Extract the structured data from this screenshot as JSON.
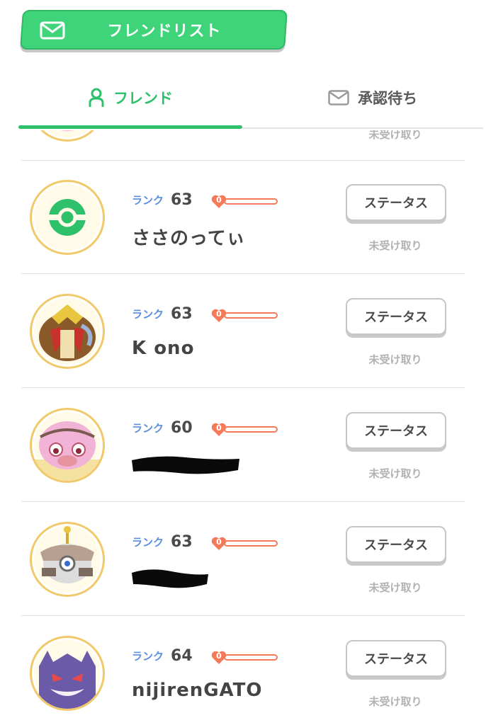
{
  "header": {
    "title": "フレンドリスト",
    "icon": "mail-icon"
  },
  "tabs": [
    {
      "label": "フレンド",
      "icon": "person-icon",
      "active": true
    },
    {
      "label": "承認待ち",
      "icon": "mail-icon",
      "active": false
    }
  ],
  "colors": {
    "accent": "#2ec06a",
    "rank_label": "#5a8fde",
    "heart": "#f47a5a"
  },
  "friends": [
    {
      "rank_label": "ランク",
      "rank": "63",
      "hearts": "0",
      "name": "ささのってぃ",
      "status_label": "ステータス",
      "gift_status": "未受け取り",
      "avatar": "pokeball-avatar"
    },
    {
      "rank_label": "ランク",
      "rank": "63",
      "hearts": "0",
      "name": "K ono",
      "status_label": "ステータス",
      "gift_status": "未受け取り",
      "avatar": "entei-avatar"
    },
    {
      "rank_label": "ランク",
      "rank": "60",
      "hearts": "0",
      "name": "",
      "status_label": "ステータス",
      "gift_status": "未受け取り",
      "avatar": "slowking-avatar"
    },
    {
      "rank_label": "ランク",
      "rank": "63",
      "hearts": "0",
      "name": "",
      "status_label": "ステータス",
      "gift_status": "未受け取り",
      "avatar": "magearna-avatar"
    },
    {
      "rank_label": "ランク",
      "rank": "64",
      "hearts": "0",
      "name": "nijirenGATO",
      "status_label": "ステータス",
      "gift_status": "未受け取り",
      "avatar": "gengar-avatar"
    }
  ],
  "partial_row": {
    "gift_status": "未受け取り"
  }
}
